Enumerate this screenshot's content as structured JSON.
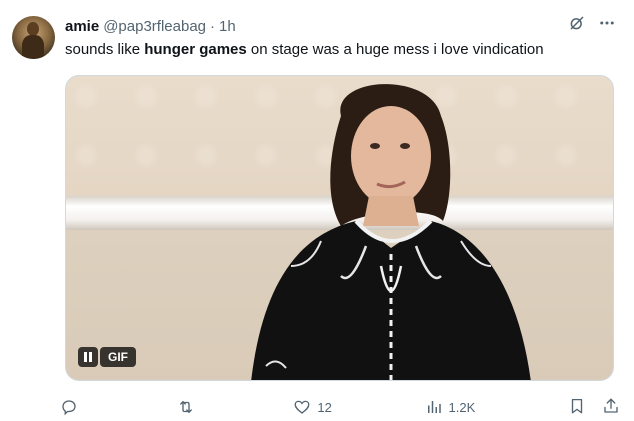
{
  "tweet": {
    "display_name": "amie",
    "handle": "@pap3rfleabag",
    "separator": "·",
    "time": "1h",
    "text_before": "sounds like ",
    "text_bold": "hunger games",
    "text_after": " on stage was a huge mess i love vindication"
  },
  "media": {
    "gif_label": "GIF"
  },
  "actions": {
    "reply_count": "",
    "retweet_count": "",
    "like_count": "12",
    "views_count": "1.2K"
  },
  "icons": {
    "grok": "grok-slash-icon",
    "more": "more-dots-icon",
    "reply": "reply-icon",
    "retweet": "retweet-icon",
    "like": "heart-icon",
    "views": "views-icon",
    "bookmark": "bookmark-icon",
    "share": "share-icon",
    "pause": "pause-icon"
  },
  "colors": {
    "text": "#0f1419",
    "muted": "#536471",
    "border": "#cfd9de"
  }
}
